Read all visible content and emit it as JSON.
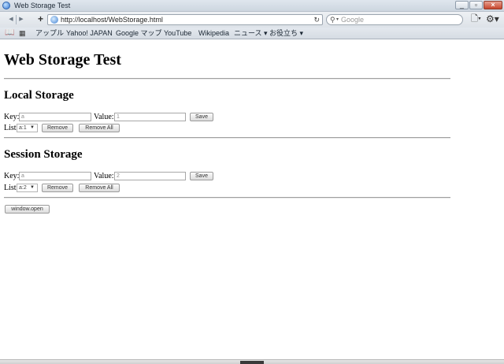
{
  "window": {
    "title": "Web Storage Test"
  },
  "toolbar": {
    "url": "http://localhost/WebStorage.html",
    "search_placeholder": "Google",
    "add_label": "+",
    "reload_glyph": "↻",
    "back_glyph": "◀",
    "forward_glyph": "▶",
    "page_menu_glyph": "🗋▾",
    "settings_glyph": "⚙▾"
  },
  "bookmarks": {
    "items": [
      {
        "label": "アップル"
      },
      {
        "label": "Yahoo! JAPAN"
      },
      {
        "label": "Google マップ"
      },
      {
        "label": "YouTube"
      },
      {
        "label": "Wikipedia"
      },
      {
        "label": "ニュース ▾"
      },
      {
        "label": "お役立ち ▾"
      }
    ]
  },
  "page": {
    "title": "Web Storage Test",
    "local": {
      "heading": "Local Storage",
      "key_label": "Key:",
      "key_value": "a",
      "value_label": "Value:",
      "value_value": "1",
      "save_label": "Save",
      "list_label": "List:",
      "list_selected": "a:1",
      "remove_label": "Remove",
      "remove_all_label": "Remove All"
    },
    "session": {
      "heading": "Session Storage",
      "key_label": "Key:",
      "key_value": "a",
      "value_label": "Value:",
      "value_value": "2",
      "save_label": "Save",
      "list_label": "List:",
      "list_selected": "a:2",
      "remove_label": "Remove",
      "remove_all_label": "Remove All"
    },
    "window_open_label": "window.open"
  },
  "colors": {
    "titlebar": "#cdd6e0",
    "toolbar": "#dde2e8",
    "hr": "#a0a0a0"
  }
}
